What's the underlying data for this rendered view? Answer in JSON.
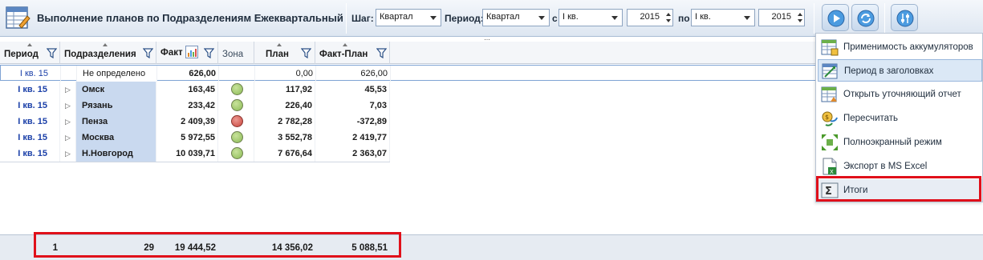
{
  "toolbar": {
    "title": "Выполнение планов по Подразделениям Ежеквартальный",
    "step_label": "Шаг:",
    "step_value": "Квартал",
    "period_label": "Период:",
    "period_value": "Квартал",
    "from_label": "с",
    "from_quarter": "I кв.",
    "from_year": "2015",
    "to_label": "по",
    "to_quarter": "I кв.",
    "to_year": "2015",
    "splitter": "..."
  },
  "columns": [
    "Период",
    "Подразделения",
    "Факт",
    "Зона",
    "План",
    "Факт-План"
  ],
  "rows": [
    {
      "period": "I кв. 15",
      "division": "Не определено",
      "expandable": false,
      "fact": "626,00",
      "zone": "none",
      "plan": "0,00",
      "diff": "626,00"
    },
    {
      "period": "I кв. 15",
      "division": "Омск",
      "expandable": true,
      "fact": "163,45",
      "zone": "green",
      "plan": "117,92",
      "diff": "45,53"
    },
    {
      "period": "I кв. 15",
      "division": "Рязань",
      "expandable": true,
      "fact": "233,42",
      "zone": "green",
      "plan": "226,40",
      "diff": "7,03"
    },
    {
      "period": "I кв. 15",
      "division": "Пенза",
      "expandable": true,
      "fact": "2 409,39",
      "zone": "red",
      "plan": "2 782,28",
      "diff": "-372,89"
    },
    {
      "period": "I кв. 15",
      "division": "Москва",
      "expandable": true,
      "fact": "5 972,55",
      "zone": "green",
      "plan": "3 552,78",
      "diff": "2 419,77"
    },
    {
      "period": "I кв. 15",
      "division": "Н.Новгород",
      "expandable": true,
      "fact": "10 039,71",
      "zone": "green",
      "plan": "7 676,64",
      "diff": "2 363,07"
    }
  ],
  "totals": {
    "period": "1",
    "division": "29",
    "fact": "19 444,52",
    "plan": "14 356,02",
    "diff": "5 088,51"
  },
  "menu": {
    "items": [
      {
        "label": "Применимость аккумуляторов",
        "icon": "table-settings-icon"
      },
      {
        "label": "Период в заголовках",
        "icon": "period-header-icon"
      },
      {
        "label": "Открыть уточняющий отчет",
        "icon": "drilldown-report-icon"
      },
      {
        "label": "Пересчитать",
        "icon": "recalculate-icon"
      },
      {
        "label": "Полноэкранный режим",
        "icon": "fullscreen-icon"
      },
      {
        "label": "Экспорт в MS Excel",
        "icon": "excel-export-icon"
      },
      {
        "label": "Итоги",
        "icon": "sigma-totals-icon"
      }
    ]
  },
  "colors": {
    "zone_green": "#9ccc6a",
    "zone_red": "#d9534f",
    "highlight": "#e0101a",
    "division_bg": "#c9d9ef"
  }
}
